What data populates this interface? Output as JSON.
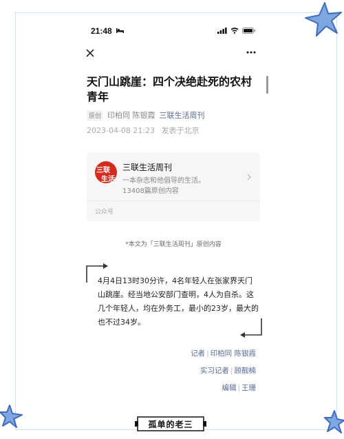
{
  "status_bar": {
    "time": "21:48"
  },
  "article": {
    "title": "天门山跳崖：四个决绝赴死的农村青年",
    "original_tag": "原创",
    "authors": "印柏同 陈银霞",
    "account": "三联生活周刊",
    "date": "2023-04-08 21:23",
    "location": "发表于北京"
  },
  "account_card": {
    "logo_text_top": "三联",
    "logo_text_bottom": "生活",
    "name": "三联生活周刊",
    "description": "一本杂志和他倡导的生活。",
    "count": "13408篇原创内容",
    "footer": "公众号"
  },
  "body": {
    "note": "*本文为「三联生活周刊」原创内容",
    "paragraph": "4月4日13时30分许，4名年轻人在张家界天门山跳崖。经当地公安部门查明，4人为自杀。这几个年轻人，均在外务工，最小的23岁，最大的也不过34岁。",
    "credits": [
      {
        "role": "记者",
        "names": "印柏同 陈银霞"
      },
      {
        "role": "实习记者",
        "names": "顾靓楠"
      },
      {
        "role": "编辑",
        "names": "王珊"
      }
    ]
  },
  "watermark": "孤单的老三",
  "colors": {
    "link": "#576b95",
    "frame": "#cfe0f2",
    "star": "#5b8fd6"
  }
}
